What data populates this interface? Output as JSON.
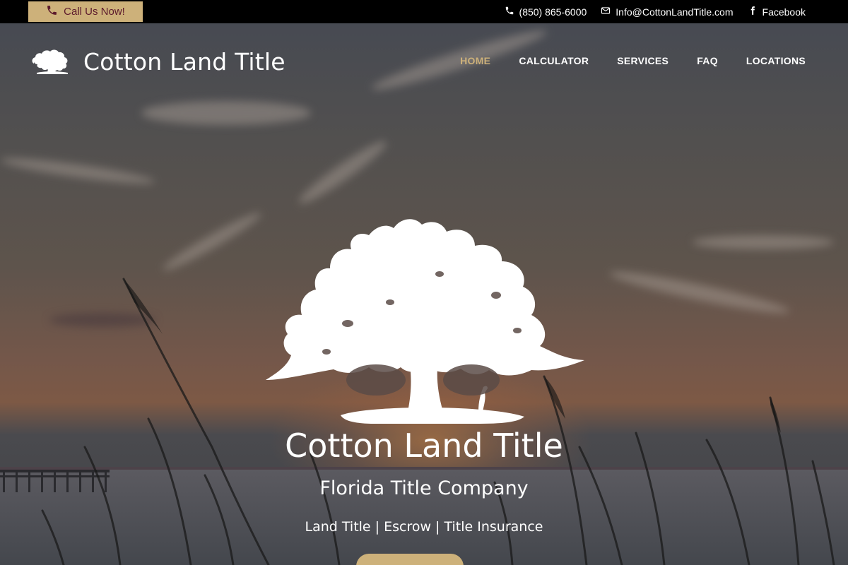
{
  "topbar": {
    "call_label": "Call Us Now!",
    "phone": "(850) 865-6000",
    "email": "Info@CottonLandTitle.com",
    "facebook": "Facebook"
  },
  "header": {
    "brand": "Cotton Land Title",
    "nav": [
      {
        "label": "HOME",
        "active": true
      },
      {
        "label": "CALCULATOR",
        "active": false
      },
      {
        "label": "SERVICES",
        "active": false
      },
      {
        "label": "FAQ",
        "active": false
      },
      {
        "label": "LOCATIONS",
        "active": false
      }
    ]
  },
  "hero": {
    "title": "Cotton Land Title",
    "subtitle": "Florida Title Company",
    "tagline": "Land Title | Escrow | Title Insurance"
  },
  "colors": {
    "accent": "#cdb17a",
    "call_text": "#5c1a2c",
    "topbar_bg": "#000000",
    "text": "#ffffff"
  },
  "icons": {
    "call": "phone-icon",
    "phone": "phone-icon",
    "email": "envelope-icon",
    "facebook": "facebook-icon",
    "logo": "oak-tree-logo"
  }
}
